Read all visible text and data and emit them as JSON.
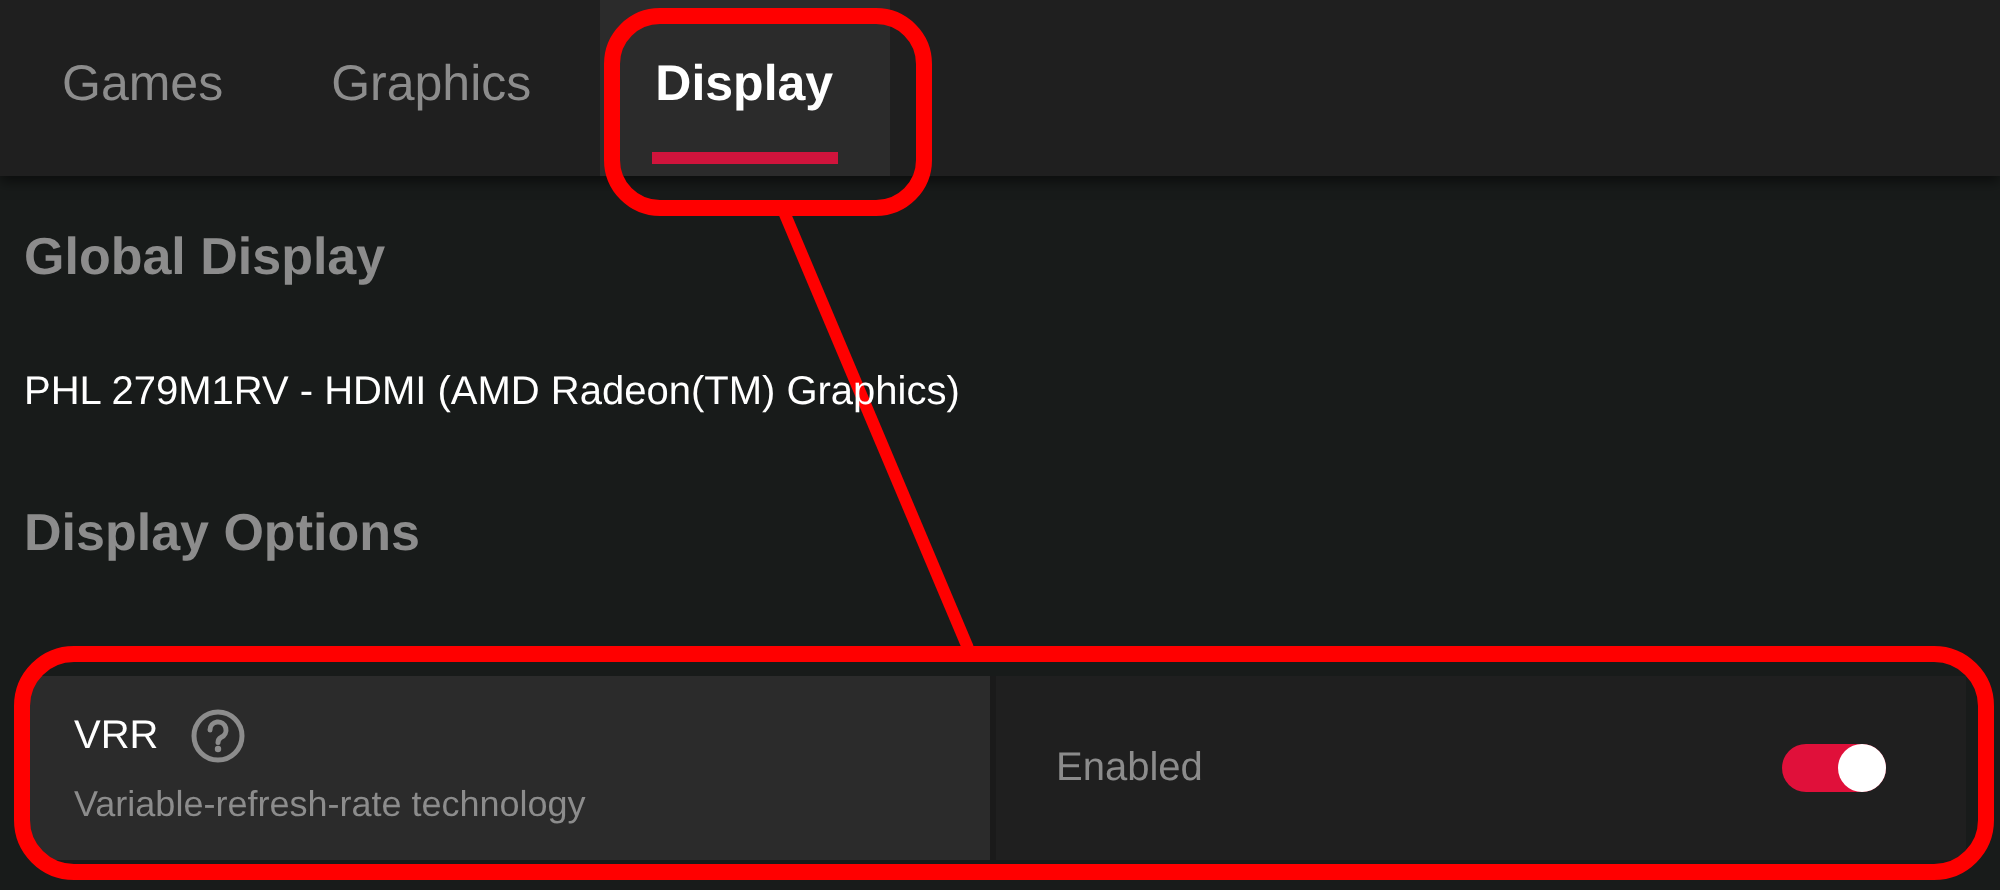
{
  "tabs": [
    {
      "label": "Games",
      "selected": false
    },
    {
      "label": "Graphics",
      "selected": false
    },
    {
      "label": "Display",
      "selected": true
    }
  ],
  "global_display": {
    "heading": "Global Display",
    "monitor": "PHL 279M1RV - HDMI (AMD Radeon(TM) Graphics)"
  },
  "display_options": {
    "heading": "Display Options",
    "settings": [
      {
        "name": "VRR",
        "description": "Variable-refresh-rate technology",
        "value": "Enabled",
        "on": true
      }
    ]
  }
}
